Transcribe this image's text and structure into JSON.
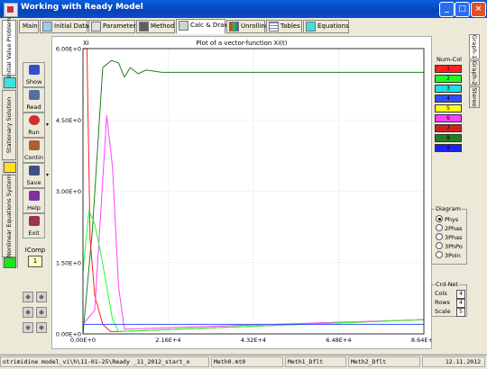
{
  "window": {
    "title": "Working with Ready Model",
    "minimize": "_",
    "maximize": "□",
    "close": "×"
  },
  "left_tabs": [
    "Initial Value Problem",
    "Stationary Solution",
    "Nonlinear Equations System"
  ],
  "tabs": [
    {
      "label": "Main",
      "icon": "none-icon",
      "active": false
    },
    {
      "label": "Initial Data",
      "icon": "data-icon",
      "active": false
    },
    {
      "label": "Parameters",
      "icon": "parameters-icon",
      "active": false
    },
    {
      "label": "Method",
      "icon": "method-icon",
      "active": false
    },
    {
      "label": "Calc & Draw",
      "icon": "plot-icon",
      "active": true
    },
    {
      "label": "Unrolling",
      "icon": "unrolling-icon",
      "active": false
    },
    {
      "label": "Tables",
      "icon": "table-icon",
      "active": false
    },
    {
      "label": "Equations",
      "icon": "equations-icon",
      "active": false
    }
  ],
  "toolbar": {
    "show": "Show",
    "read": "Read",
    "run": "Run",
    "contin": "Contin",
    "save": "Save",
    "help": "Help",
    "exit": "Exit"
  },
  "icomp": {
    "label": "IComp",
    "value": "1"
  },
  "right_tabs": [
    "Graph-1",
    "Graph-2",
    "Stereo"
  ],
  "num_col": {
    "label": "Num-Col",
    "items": [
      {
        "n": "1",
        "color": "#ff2020"
      },
      {
        "n": "2",
        "color": "#20ff20"
      },
      {
        "n": "3",
        "color": "#20e0e0"
      },
      {
        "n": "4",
        "color": "#3050ff"
      },
      {
        "n": "5",
        "color": "#ffff20"
      },
      {
        "n": "6",
        "color": "#ff40ff"
      },
      {
        "n": "7",
        "color": "#d02020"
      },
      {
        "n": "8",
        "color": "#208020"
      },
      {
        "n": "9",
        "color": "#2020ff"
      }
    ]
  },
  "diagram": {
    "title": "Diagram",
    "options": [
      "Phys",
      "2Phas",
      "3Phas",
      "3PhPo",
      "3Poin"
    ],
    "selected": "Phys"
  },
  "crd_net": {
    "title": "Crd-Net",
    "cols_label": "Cols",
    "cols": "4",
    "rows_label": "Rows",
    "rows": "4",
    "scale_label": "Scale",
    "scale": "5"
  },
  "status": {
    "path": "otrimidine model_vi\\h\\11-01-25\\Ready _11_2012_start_o",
    "file": "Meth0.mt0",
    "meth1": "Meth1_Dflt",
    "meth2": "Meth2_Dflt",
    "date": "12.11.2012"
  },
  "chart_data": {
    "type": "line",
    "title": "Plot of a vector-function Xi(t)",
    "ylabel": "Xi",
    "xlabel": "",
    "xlim": [
      0,
      86400
    ],
    "ylim": [
      0,
      6
    ],
    "x_ticks": [
      "0.00E+0",
      "2.16E+4",
      "4.32E+4",
      "6.48E+4",
      "8.64E+4"
    ],
    "y_ticks": [
      "0.00E+0",
      "1.50E+0",
      "3.00E+0",
      "4.50E+0",
      "6.00E+0"
    ],
    "grid": true,
    "series": [
      {
        "color": "#208020",
        "points": [
          [
            0,
            0
          ],
          [
            2400,
            2.2
          ],
          [
            5000,
            5.6
          ],
          [
            7200,
            5.75
          ],
          [
            9000,
            5.7
          ],
          [
            10500,
            5.4
          ],
          [
            12000,
            5.6
          ],
          [
            14000,
            5.47
          ],
          [
            16000,
            5.55
          ],
          [
            20000,
            5.5
          ],
          [
            86400,
            5.5
          ]
        ]
      },
      {
        "color": "#ff2020",
        "points": [
          [
            0,
            6
          ],
          [
            1000,
            6
          ],
          [
            1800,
            2.0
          ],
          [
            3000,
            0.8
          ],
          [
            5000,
            0.2
          ],
          [
            7000,
            0.05
          ],
          [
            9000,
            0.05
          ],
          [
            86400,
            0.3
          ]
        ]
      },
      {
        "color": "#ff40ff",
        "points": [
          [
            0,
            0.2
          ],
          [
            3000,
            0.5
          ],
          [
            6000,
            4.6
          ],
          [
            7500,
            3.5
          ],
          [
            9000,
            1.0
          ],
          [
            10500,
            0.1
          ],
          [
            86400,
            0.3
          ]
        ]
      },
      {
        "color": "#20ff20",
        "points": [
          [
            0,
            1.3
          ],
          [
            1500,
            2.6
          ],
          [
            3000,
            2.3
          ],
          [
            4500,
            1.7
          ],
          [
            6000,
            1.0
          ],
          [
            7500,
            0.3
          ],
          [
            9000,
            0.05
          ],
          [
            86400,
            0.3
          ]
        ]
      },
      {
        "color": "#3050ff",
        "points": [
          [
            0,
            0.2
          ],
          [
            86400,
            0.2
          ]
        ]
      }
    ]
  }
}
